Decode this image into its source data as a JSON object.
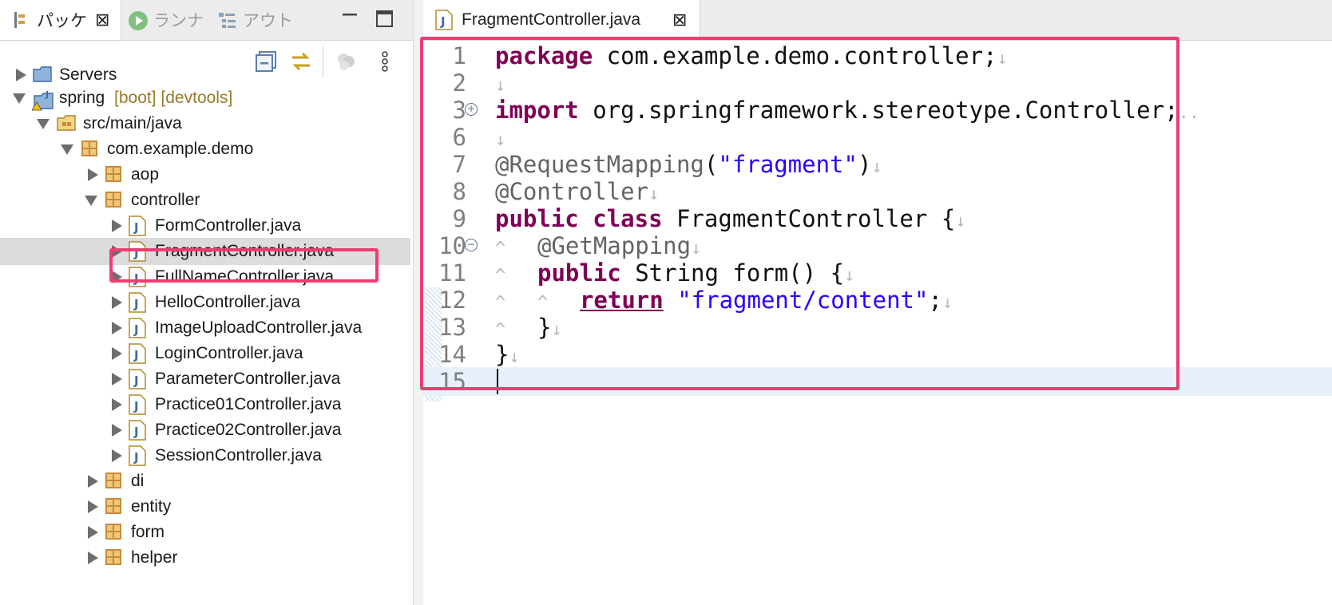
{
  "left_panel": {
    "tabs": [
      {
        "label": "パッケ",
        "active": true
      },
      {
        "label": "ランナ",
        "active": false
      },
      {
        "label": "アウト",
        "active": false
      }
    ],
    "tree": [
      {
        "label": "Servers",
        "decoration": "",
        "depth": 0,
        "expanded": false,
        "icon": "server-folder-icon"
      },
      {
        "label": "spring",
        "decoration": "[boot] [devtools]",
        "depth": 0,
        "expanded": true,
        "icon": "project-icon"
      },
      {
        "label": "src/main/java",
        "decoration": "",
        "depth": 1,
        "expanded": true,
        "icon": "source-folder-icon"
      },
      {
        "label": "com.example.demo",
        "decoration": "",
        "depth": 2,
        "expanded": true,
        "icon": "package-icon"
      },
      {
        "label": "aop",
        "decoration": "",
        "depth": 3,
        "expanded": false,
        "icon": "package-icon"
      },
      {
        "label": "controller",
        "decoration": "",
        "depth": 3,
        "expanded": true,
        "icon": "package-icon"
      },
      {
        "label": "FormController.java",
        "decoration": "",
        "depth": 4,
        "expanded": false,
        "icon": "java-file-icon"
      },
      {
        "label": "FragmentController.java",
        "decoration": "",
        "depth": 4,
        "expanded": false,
        "icon": "java-file-icon",
        "selected": true
      },
      {
        "label": "FullNameController.java",
        "decoration": "",
        "depth": 4,
        "expanded": false,
        "icon": "java-file-icon"
      },
      {
        "label": "HelloController.java",
        "decoration": "",
        "depth": 4,
        "expanded": false,
        "icon": "java-file-icon"
      },
      {
        "label": "ImageUploadController.java",
        "decoration": "",
        "depth": 4,
        "expanded": false,
        "icon": "java-file-icon"
      },
      {
        "label": "LoginController.java",
        "decoration": "",
        "depth": 4,
        "expanded": false,
        "icon": "java-file-icon"
      },
      {
        "label": "ParameterController.java",
        "decoration": "",
        "depth": 4,
        "expanded": false,
        "icon": "java-file-icon"
      },
      {
        "label": "Practice01Controller.java",
        "decoration": "",
        "depth": 4,
        "expanded": false,
        "icon": "java-file-icon"
      },
      {
        "label": "Practice02Controller.java",
        "decoration": "",
        "depth": 4,
        "expanded": false,
        "icon": "java-file-icon"
      },
      {
        "label": "SessionController.java",
        "decoration": "",
        "depth": 4,
        "expanded": false,
        "icon": "java-file-icon"
      },
      {
        "label": "di",
        "decoration": "",
        "depth": 3,
        "expanded": false,
        "icon": "package-icon"
      },
      {
        "label": "entity",
        "decoration": "",
        "depth": 3,
        "expanded": false,
        "icon": "package-icon"
      },
      {
        "label": "form",
        "decoration": "",
        "depth": 3,
        "expanded": false,
        "icon": "package-icon"
      },
      {
        "label": "helper",
        "decoration": "",
        "depth": 3,
        "expanded": false,
        "icon": "package-icon"
      }
    ]
  },
  "editor": {
    "tab_label": "FragmentController.java",
    "lines": [
      {
        "num": "1",
        "tokens": [
          {
            "t": "package",
            "c": "kw"
          },
          {
            "t": " com.example.demo.controller;",
            "c": ""
          },
          {
            "t": "↓",
            "c": "ws"
          }
        ]
      },
      {
        "num": "2",
        "tokens": [
          {
            "t": "↓",
            "c": "ws"
          }
        ]
      },
      {
        "num": "3",
        "fold": "+",
        "tokens": [
          {
            "t": "import",
            "c": "kw"
          },
          {
            "t": " org.springframework.stereotype.Controller;",
            "c": ""
          },
          {
            "t": "..",
            "c": "ws"
          }
        ]
      },
      {
        "num": "6",
        "tokens": [
          {
            "t": "↓",
            "c": "ws"
          }
        ]
      },
      {
        "num": "7",
        "tokens": [
          {
            "t": "@RequestMapping",
            "c": "ann"
          },
          {
            "t": "(",
            "c": ""
          },
          {
            "t": "\"fragment\"",
            "c": "str"
          },
          {
            "t": ")",
            "c": ""
          },
          {
            "t": "↓",
            "c": "ws"
          }
        ]
      },
      {
        "num": "8",
        "tokens": [
          {
            "t": "@Controller",
            "c": "ann"
          },
          {
            "t": "↓",
            "c": "ws"
          }
        ]
      },
      {
        "num": "9",
        "tokens": [
          {
            "t": "public",
            "c": "kw"
          },
          {
            "t": " ",
            "c": ""
          },
          {
            "t": "class",
            "c": "kw"
          },
          {
            "t": " FragmentController {",
            "c": ""
          },
          {
            "t": "↓",
            "c": "ws"
          }
        ]
      },
      {
        "num": "10",
        "fold": "−",
        "tokens": [
          {
            "t": "^   ",
            "c": "ws"
          },
          {
            "t": "@GetMapping",
            "c": "ann"
          },
          {
            "t": "↓",
            "c": "ws"
          }
        ]
      },
      {
        "num": "11",
        "tokens": [
          {
            "t": "^   ",
            "c": "ws"
          },
          {
            "t": "public",
            "c": "kw"
          },
          {
            "t": " String form() {",
            "c": ""
          },
          {
            "t": "↓",
            "c": "ws"
          }
        ]
      },
      {
        "num": "12",
        "tokens": [
          {
            "t": "^   ^   ",
            "c": "ws"
          },
          {
            "t": "return",
            "c": "kw ul"
          },
          {
            "t": " ",
            "c": ""
          },
          {
            "t": "\"fragment/content\"",
            "c": "str"
          },
          {
            "t": ";",
            "c": ""
          },
          {
            "t": "↓",
            "c": "ws"
          }
        ]
      },
      {
        "num": "13",
        "tokens": [
          {
            "t": "^   ",
            "c": "ws"
          },
          {
            "t": "}",
            "c": ""
          },
          {
            "t": "↓",
            "c": "ws"
          }
        ]
      },
      {
        "num": "14",
        "tokens": [
          {
            "t": "}",
            "c": ""
          },
          {
            "t": "↓",
            "c": "ws"
          }
        ]
      },
      {
        "num": "15",
        "current": true,
        "tokens": []
      }
    ]
  }
}
